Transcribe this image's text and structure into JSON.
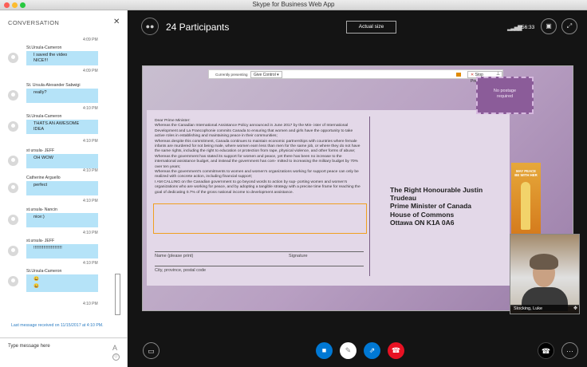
{
  "window": {
    "title": "Skype for Business Web App"
  },
  "conversation": {
    "title": "CONVERSATION",
    "close_label": "✕",
    "first_time": "4:09 PM",
    "messages": [
      {
        "sender": "St.Ursula-Cameron",
        "lines": [
          "I saved the video",
          "NICE!!!"
        ],
        "time": "4:09 PM"
      },
      {
        "sender": "St. Ursula-Alexander Sabwigi",
        "lines": [
          "really?"
        ],
        "time": "4:10 PM"
      },
      {
        "sender": "St.Ursula-Cameron",
        "lines": [
          "THATS AN AWESOME",
          "IDEA"
        ],
        "time": "4:10 PM"
      },
      {
        "sender": "st ursula- JEFF",
        "lines": [
          "OH WOW"
        ],
        "time": "4:10 PM"
      },
      {
        "sender": "Catherine Arguello",
        "lines": [
          "perfect"
        ],
        "time": "4:10 PM"
      },
      {
        "sender": "st.ursula- Nancin",
        "lines": [
          "nice:)"
        ],
        "time": "4:10 PM"
      },
      {
        "sender": "st.ursula- JEFF",
        "lines": [
          "!!!!!!!!!!!!!!!!!!!!!!!"
        ],
        "time": "4:10 PM"
      },
      {
        "sender": "St.Ursula-Cameron",
        "lines": [
          "😀",
          "😀"
        ],
        "time": "4:10 PM"
      }
    ],
    "last_message": "Last message received on 11/15/2017 at 4:10 PM.",
    "composer_placeholder": "Type message here",
    "composer_font_icon": "A"
  },
  "stage": {
    "participants": "24 Participants",
    "actual_size": "Actual size",
    "timer": "56:33",
    "presenting_label": "Currently presenting",
    "give_control": "Give Control ▾",
    "stop_presenting": "Stop Presenting",
    "video_name": "Stocking, Luke"
  },
  "postcard": {
    "letter": [
      "Dear Prime Minister:",
      "Whereas the Canadian International Assistance Policy announced in June 2017 by the Min- ister of International Development and La Francophonie commits Canada to ensuring that women and girls have the opportunity to take active roles in establishing and maintaining peace in their communities;",
      "Whereas despite this commitment, Canada continues to maintain economic partnerships with countries where female infants are murdered for not being male, where women earn less than men for the same job, or where they do not have the same rights, including the right to education or protection from rape, physical violence, and other forms of abuse;",
      "Whereas the government has stated its support for women and peace, yet there has been no increase to the international assistance budget, and instead the government has com- mitted to increasing the military budget by 70% over ten years;",
      "Whereas the government's commitments to women and women's organizations working for support peace can only be realized with concrete action, including financial support;",
      "I AM CALLING on the Canadian government to go beyond words to action by sup- porting women and women's organizations who are working for peace, and by adopting a tangible strategy with a precise time frame for reaching the goal of dedicating 0.7% of the gross national income to development assistance."
    ],
    "name_label": "Name (please print)",
    "signature_label": "Signature",
    "city_label": "City, province, postal code",
    "address": [
      "The Right Honourable Justin Trudeau",
      "Prime Minister of Canada",
      "House of Commons",
      "Ottawa ON  K1A 0A6"
    ],
    "stamp": [
      "No postage",
      "required"
    ],
    "poster_text": "MAY PEACE BE WITH HER"
  }
}
